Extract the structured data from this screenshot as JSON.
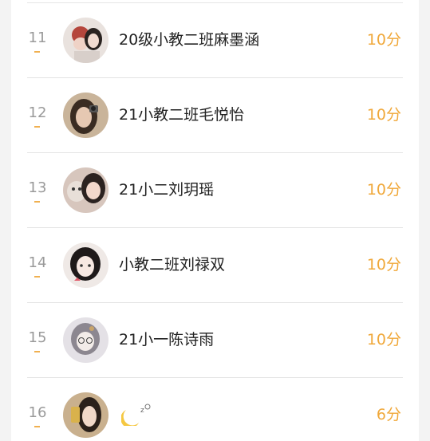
{
  "leaderboard": {
    "rows": [
      {
        "rank": "11",
        "name": "20级小教二班麻墨涵",
        "score": "10分",
        "avatar": "avatar-photo-1"
      },
      {
        "rank": "12",
        "name": "21小教二班毛悦怡",
        "score": "10分",
        "avatar": "avatar-photo-2"
      },
      {
        "rank": "13",
        "name": "21小二刘玥瑶",
        "score": "10分",
        "avatar": "avatar-photo-3"
      },
      {
        "rank": "14",
        "name": "小教二班刘禄双",
        "score": "10分",
        "avatar": "avatar-illustration-1"
      },
      {
        "rank": "15",
        "name": "21小一陈诗雨",
        "score": "10分",
        "avatar": "avatar-illustration-2"
      },
      {
        "rank": "16",
        "name": "",
        "score": "6分",
        "avatar": "avatar-photo-4",
        "name_icon": "moon-icon"
      }
    ]
  },
  "colors": {
    "score": "#f0a83a",
    "rank_marker": "#f0b050",
    "rank_text": "#9a9a9a",
    "name_text": "#222222",
    "divider": "#e3e3e3"
  }
}
